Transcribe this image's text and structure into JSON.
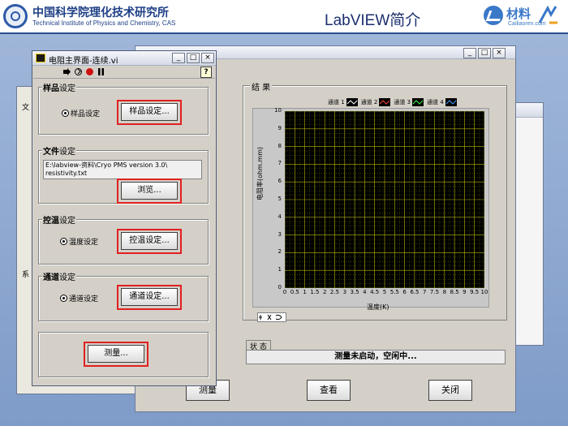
{
  "header": {
    "institute_cn": "中国科学院理化技术研究所",
    "institute_en": "Technical Institute of Physics and Chemistry, CAS",
    "slide_title": "LabVIEW简介",
    "brand_cn": "材料",
    "brand_en": "Cailiaoren.com"
  },
  "vi_window": {
    "title": "电阻主界面-连续.vi",
    "sample_group": {
      "label_bold": "样品",
      "label_rest": "设定",
      "radio": "样品设定",
      "button": "样品设定..."
    },
    "file_group": {
      "label_bold": "文件",
      "label_rest": "设定",
      "path": "E:\\labview-资料\\Cryo PMS version 3.0\\ resistivity.txt",
      "button": "浏览..."
    },
    "temp_group": {
      "label_bold": "控温",
      "label_rest": "设定",
      "radio": "温度设定",
      "button": "控温设定..."
    },
    "channel_group": {
      "label_bold": "通道",
      "label_rest": "设定",
      "radio": "通道设定",
      "button": "通道设定..."
    },
    "measure_button": "测量..."
  },
  "main_window": {
    "results_label": "结 果",
    "status_label": "状 态",
    "status_text": "测量未启动，空闲中...",
    "buttons": {
      "measure": "测量",
      "view": "查看",
      "close": "关闭"
    },
    "background_tab_label": "文",
    "background_side_label": "系"
  },
  "chart_data": {
    "type": "line",
    "title": "",
    "xlabel": "温度(K)",
    "ylabel": "电阻率(ohm.mm)",
    "xlim": [
      0,
      10
    ],
    "ylim": [
      0,
      10
    ],
    "x_ticks": [
      "0",
      "0.5",
      "1",
      "1.5",
      "2",
      "2.5",
      "3",
      "3.5",
      "4",
      "4.5",
      "5",
      "5.5",
      "6",
      "6.5",
      "7",
      "7.5",
      "8",
      "8.5",
      "9",
      "9.5",
      "10"
    ],
    "y_ticks": [
      "0",
      "1",
      "2",
      "3",
      "4",
      "5",
      "6",
      "7",
      "8",
      "9",
      "10"
    ],
    "grid": true,
    "legend_position": "top-right",
    "series": [
      {
        "name": "通道 1",
        "values": []
      },
      {
        "name": "通道 2",
        "values": []
      },
      {
        "name": "通道 3",
        "values": []
      },
      {
        "name": "通道 4",
        "values": []
      }
    ],
    "colors": {
      "plot_bg": "#000000",
      "grid": "#b5b800",
      "ch1": "#ffffff",
      "ch2": "#ff4040",
      "ch3": "#40ff40",
      "ch4": "#40a0ff"
    }
  }
}
